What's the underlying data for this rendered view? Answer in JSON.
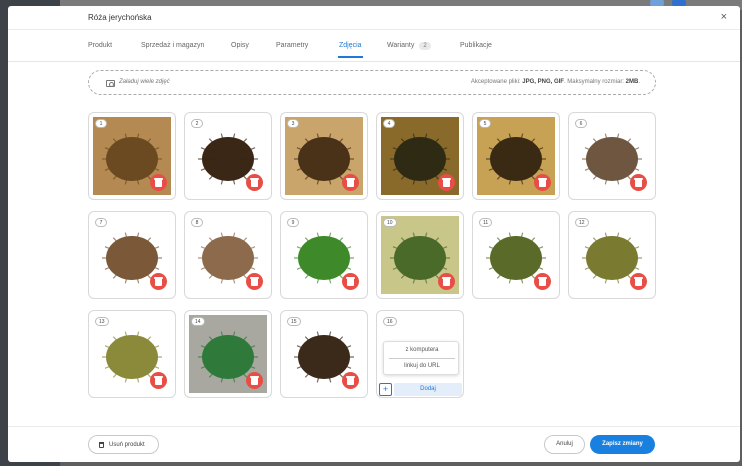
{
  "modal": {
    "title": "Róża jerychońska",
    "close_glyph": "×"
  },
  "tabs": [
    {
      "label": "Produkt"
    },
    {
      "label": "Sprzedaż i magazyn"
    },
    {
      "label": "Opisy"
    },
    {
      "label": "Parametry"
    },
    {
      "label": "Zdjęcia",
      "active": true
    },
    {
      "label": "Warianty",
      "badge": "2"
    },
    {
      "label": "Publikacje"
    }
  ],
  "upload": {
    "label": "Załaduj wiele zdjęć",
    "info_prefix": "Akceptowane pliki:",
    "info_types": "JPG, PNG, GIF",
    "info_mid": ". Maksymalny rozmiar:",
    "info_size": "2MB",
    "info_suffix": "."
  },
  "images": [
    {
      "number": "1",
      "bg": "#b48a52",
      "fg": "#6b4a22"
    },
    {
      "number": "2",
      "bg": "#ffffff",
      "fg": "#3b2716"
    },
    {
      "number": "3",
      "bg": "#c9a46b",
      "fg": "#4a3218"
    },
    {
      "number": "4",
      "bg": "#8a6a2a",
      "fg": "#2f2a14"
    },
    {
      "number": "5",
      "bg": "#c7a255",
      "fg": "#3a2a14"
    },
    {
      "number": "6",
      "bg": "#ffffff",
      "fg": "#6e5640"
    },
    {
      "number": "7",
      "bg": "#ffffff",
      "fg": "#7a5838"
    },
    {
      "number": "8",
      "bg": "#ffffff",
      "fg": "#8d6a4c"
    },
    {
      "number": "9",
      "bg": "#ffffff",
      "fg": "#3e8a2a"
    },
    {
      "number": "10",
      "bg": "#c9c68a",
      "fg": "#4a6a2a"
    },
    {
      "number": "11",
      "bg": "#ffffff",
      "fg": "#5a6a28"
    },
    {
      "number": "12",
      "bg": "#ffffff",
      "fg": "#7a7a30"
    },
    {
      "number": "13",
      "bg": "#ffffff",
      "fg": "#8a8a3a"
    },
    {
      "number": "14",
      "bg": "#a8a8a0",
      "fg": "#2f7a3a"
    },
    {
      "number": "15",
      "bg": "#ffffff",
      "fg": "#3b2a1a"
    }
  ],
  "add_slot": {
    "number": "16",
    "option_computer": "z komputera",
    "option_url": "linkuj do URL",
    "plus_glyph": "+",
    "add_label": "Dodaj"
  },
  "footer": {
    "remove_label": "Usuń produkt",
    "cancel_label": "Anuluj",
    "save_label": "Zapisz zmiany"
  },
  "colors": {
    "accent": "#1e7ad6",
    "danger": "#e84e45",
    "save_button": "#1a80e0"
  }
}
